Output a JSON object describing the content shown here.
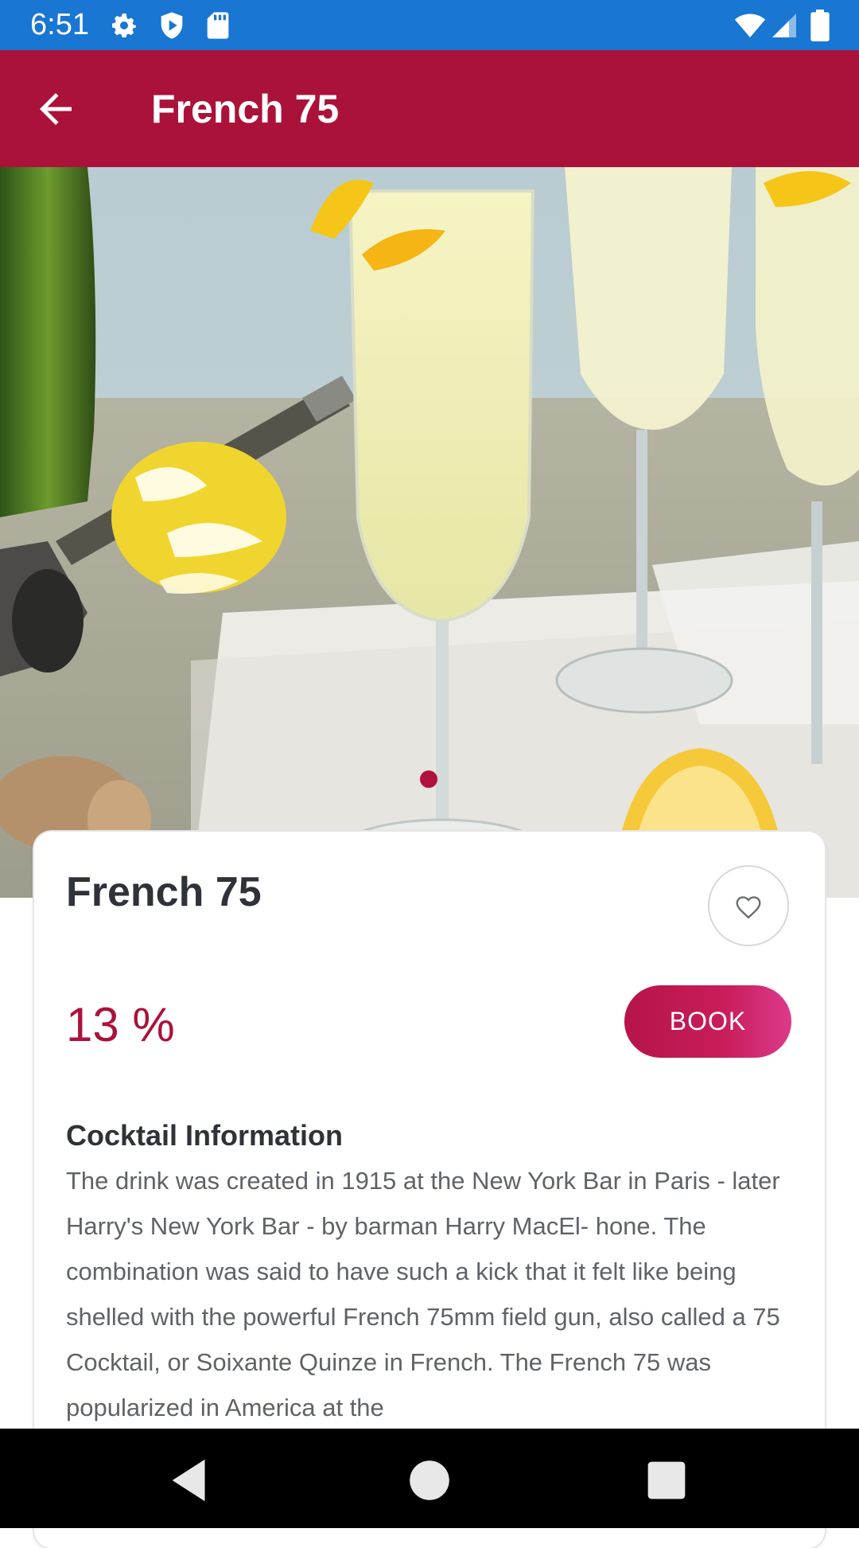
{
  "status_bar": {
    "time": "6:51",
    "icons": [
      "gear-icon",
      "shield-play-icon",
      "sd-card-icon",
      "wifi-icon",
      "signal-icon",
      "battery-icon"
    ]
  },
  "app_bar": {
    "title": "French 75",
    "back_icon": "arrow-left-icon",
    "color": "#ab123a"
  },
  "hero": {
    "image_subject": "French 75 cocktail flutes with lemon",
    "carousel_dot_color": "#b1123b"
  },
  "card": {
    "title": "French 75",
    "favorite_icon": "heart-outline-icon",
    "abv": "13 %",
    "book_label": "BOOK",
    "section_title": "Cocktail Information",
    "description": "The drink was created in 1915 at the New York Bar in Paris - later Harry's New York Bar - by barman Harry MacEl- hone. The combination was said to have such a kick that it felt like being shelled with the powerful French 75mm field gun, also called a 75 Cocktail, or Soixante Quinze in French. The French 75 was popularized in America at the"
  },
  "nav_bar": {
    "icons": [
      "back-triangle-icon",
      "home-circle-icon",
      "recents-square-icon"
    ]
  }
}
